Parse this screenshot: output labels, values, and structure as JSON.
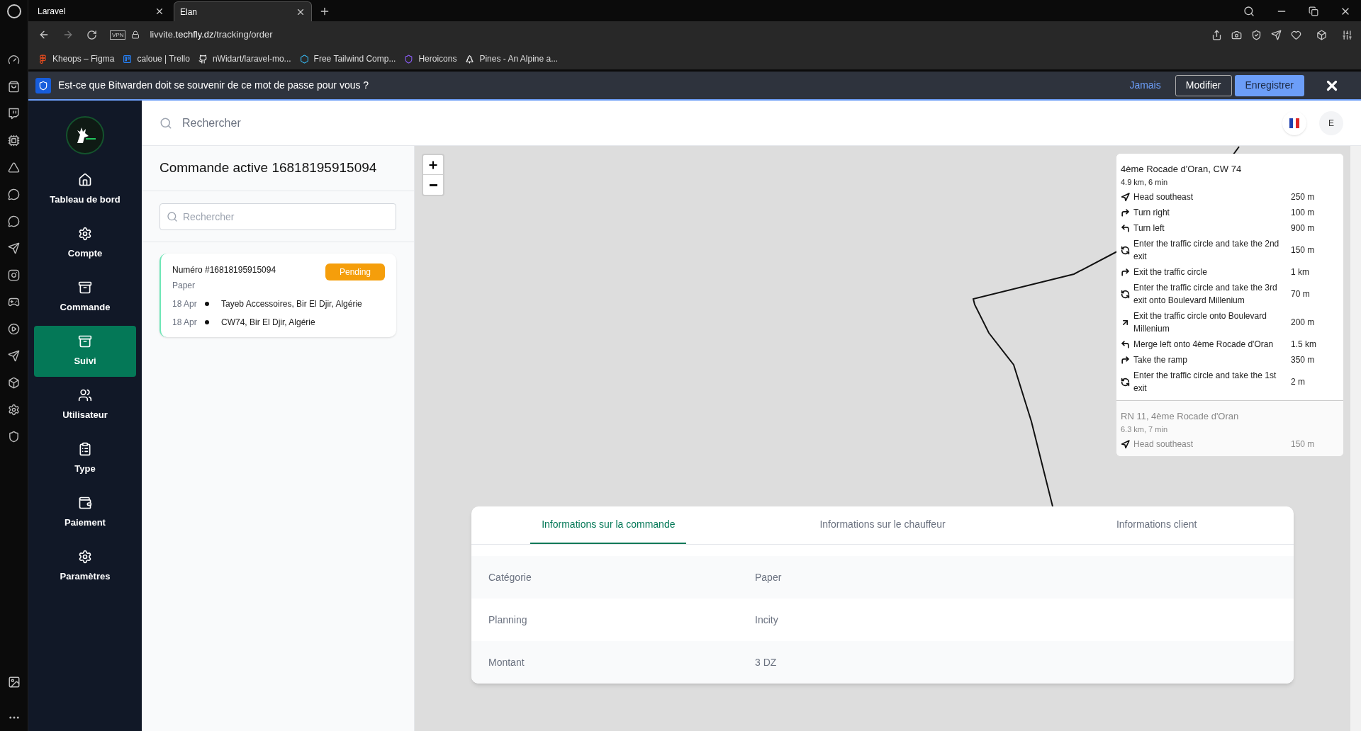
{
  "browser": {
    "tabs": [
      {
        "title": "Laravel",
        "selected": false
      },
      {
        "title": "Elan",
        "selected": true
      }
    ],
    "url": {
      "host": "livvite.",
      "domain": "techfly.dz",
      "path": "/tracking/order"
    },
    "vpn_badge": "VPN",
    "bookmarks": [
      "Kheops – Figma",
      "caloue | Trello",
      "nWidart/laravel-mo...",
      "Free Tailwind Comp...",
      "Heroicons",
      "Pines - An Alpine a..."
    ]
  },
  "password_prompt": {
    "message": "Est-ce que Bitwarden doit se souvenir de ce mot de passe pour vous ?",
    "never_link": "Jamais",
    "edit_button": "Modifier",
    "save_button": "Enregistrer"
  },
  "sidebar": {
    "items": [
      {
        "label": "Tableau de bord",
        "selected": false
      },
      {
        "label": "Compte",
        "selected": false
      },
      {
        "label": "Commande",
        "selected": false
      },
      {
        "label": "Suivi",
        "selected": true
      },
      {
        "label": "Utilisateur",
        "selected": false
      },
      {
        "label": "Type",
        "selected": false
      },
      {
        "label": "Paiement",
        "selected": false
      },
      {
        "label": "Paramètres",
        "selected": false
      }
    ]
  },
  "header": {
    "search_placeholder": "Rechercher",
    "avatar": "E"
  },
  "orders_panel": {
    "title": "Commande active 16818195915094",
    "search_placeholder": "Rechercher",
    "orders": [
      {
        "number": "Numéro #16818195915094",
        "status": "Pending",
        "category": "Paper",
        "stops": [
          {
            "date": "18 Apr",
            "address": "Tayeb Accessoires, Bir El Djir, Algérie"
          },
          {
            "date": "18 Apr",
            "address": "CW74, Bir El Djir, Algérie"
          }
        ]
      }
    ]
  },
  "map": {
    "routes": [
      {
        "name": "4ème Rocade d'Oran, CW 74",
        "summary": "4.9 km, 6 min",
        "selected": true,
        "steps": [
          {
            "kind": "depart",
            "text": "Head southeast",
            "distance": "250 m"
          },
          {
            "kind": "right",
            "text": "Turn right",
            "distance": "100 m"
          },
          {
            "kind": "left",
            "text": "Turn left",
            "distance": "900 m"
          },
          {
            "kind": "roundabout",
            "text": "Enter the traffic circle and take the 2nd exit",
            "distance": "150 m"
          },
          {
            "kind": "right",
            "text": "Exit the traffic circle",
            "distance": "1 km"
          },
          {
            "kind": "roundabout",
            "text": "Enter the traffic circle and take the 3rd exit onto Boulevard Millenium",
            "distance": "70 m"
          },
          {
            "kind": "slight-right",
            "text": "Exit the traffic circle onto Boulevard Millenium",
            "distance": "200 m"
          },
          {
            "kind": "left",
            "text": "Merge left onto 4ème Rocade d'Oran",
            "distance": "1.5 km"
          },
          {
            "kind": "right",
            "text": "Take the ramp",
            "distance": "350 m"
          },
          {
            "kind": "roundabout",
            "text": "Enter the traffic circle and take the 1st exit",
            "distance": "2 m"
          }
        ]
      },
      {
        "name": "RN 11, 4ème Rocade d'Oran",
        "summary": "6.3 km, 7 min",
        "selected": false,
        "steps": [
          {
            "kind": "depart",
            "text": "Head southeast",
            "distance": "150 m"
          }
        ]
      }
    ]
  },
  "details": {
    "tabs": [
      {
        "label": "Informations sur la commande",
        "selected": true
      },
      {
        "label": "Informations sur le chauffeur",
        "selected": false
      },
      {
        "label": "Informations client",
        "selected": false
      }
    ],
    "rows": [
      {
        "label": "Catégorie",
        "value": "Paper"
      },
      {
        "label": "Planning",
        "value": "Incity"
      },
      {
        "label": "Montant",
        "value": "3 DZ"
      }
    ]
  }
}
